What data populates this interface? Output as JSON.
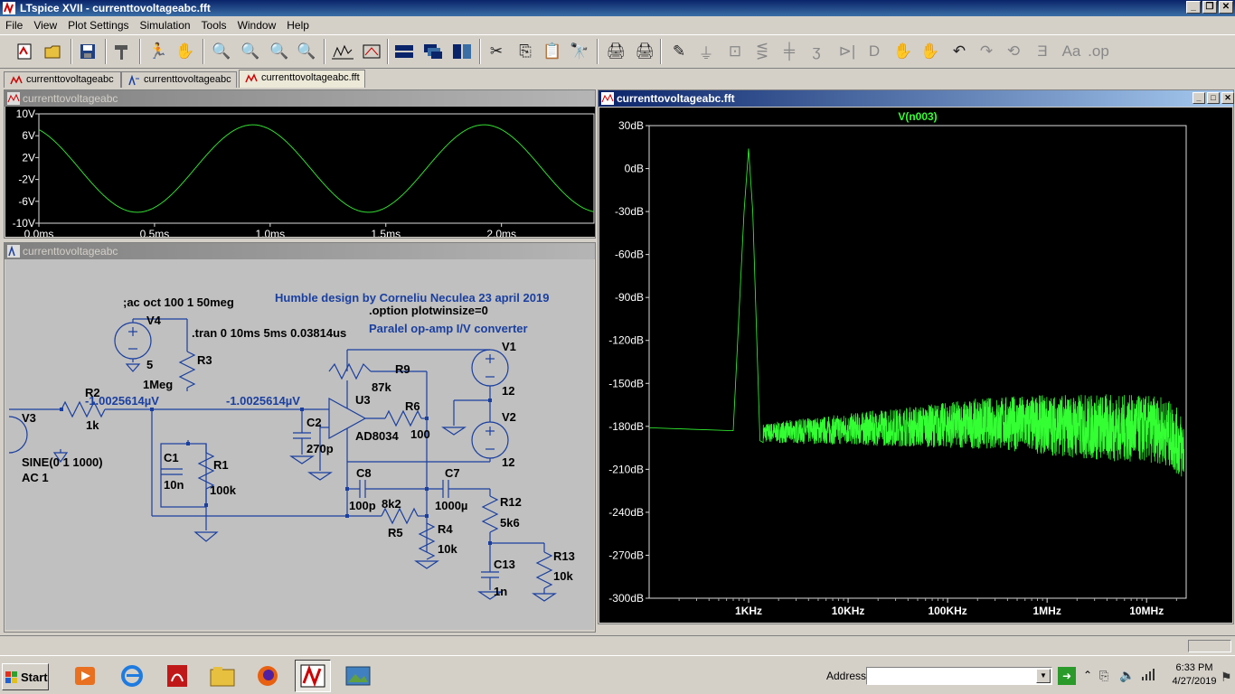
{
  "window": {
    "title": "LTspice XVII - currenttovoltageabc.fft"
  },
  "menu": [
    "File",
    "View",
    "Plot Settings",
    "Simulation",
    "Tools",
    "Window",
    "Help"
  ],
  "tabs": [
    {
      "label": "currenttovoltageabc",
      "type": "waveform"
    },
    {
      "label": "currenttovoltageabc",
      "type": "schematic"
    },
    {
      "label": "currenttovoltageabc.fft",
      "type": "waveform",
      "active": true
    }
  ],
  "transient_window": {
    "title": "currenttovoltageabc",
    "chart_data": {
      "type": "line",
      "series": [
        {
          "name": "",
          "description": "sine 8V amplitude, 1 kHz",
          "amplitude": 8,
          "frequency_hz": 1000
        }
      ],
      "x_ticks": [
        "0.0ms",
        "0.5ms",
        "1.0ms",
        "1.5ms",
        "2.0ms"
      ],
      "y_ticks": [
        "10V",
        "6V",
        "2V",
        "-2V",
        "-6V",
        "-10V"
      ],
      "xlim": [
        0,
        2.4
      ],
      "ylim": [
        -10,
        10
      ],
      "color": "#33dd33"
    }
  },
  "schematic_window": {
    "title": "currenttovoltageabc",
    "texts": {
      "heading": "Humble design by Corneliu Neculea 23 april 2019",
      "option": ".option plotwinsize=0",
      "subtitle": "Paralel op-amp I/V converter",
      "ac_directive": ";ac oct 100 1 50meg",
      "tran_directive": ".tran 0 10ms 5ms 0.03814us",
      "node_voltage_left": "-1.0025614µV",
      "node_voltage_right": "-1.0025614µV",
      "v3_sine": "SINE(0 1 1000)",
      "v3_ac": "AC 1"
    },
    "components": [
      {
        "ref": "V4",
        "value": "5"
      },
      {
        "ref": "R3",
        "value": "1Meg"
      },
      {
        "ref": "R2",
        "value": "1k"
      },
      {
        "ref": "V3",
        "value": ""
      },
      {
        "ref": "C1",
        "value": "10n"
      },
      {
        "ref": "R1",
        "value": "100k"
      },
      {
        "ref": "C2",
        "value": "270p"
      },
      {
        "ref": "U3",
        "value": "AD8034"
      },
      {
        "ref": "R9",
        "value": "87k"
      },
      {
        "ref": "R6",
        "value": "100"
      },
      {
        "ref": "V1",
        "value": "12"
      },
      {
        "ref": "V2",
        "value": "12"
      },
      {
        "ref": "C8",
        "value": "100p"
      },
      {
        "ref": "R5",
        "value": "8k2"
      },
      {
        "ref": "C7",
        "value": "1000µ"
      },
      {
        "ref": "R4",
        "value": "10k"
      },
      {
        "ref": "R12",
        "value": "5k6"
      },
      {
        "ref": "C13",
        "value": "1n"
      },
      {
        "ref": "R13",
        "value": "10k"
      }
    ]
  },
  "fft_window": {
    "title": "currenttovoltageabc.fft",
    "chart_data": {
      "type": "line",
      "title": "V(n003)",
      "series": [
        {
          "name": "V(n003)",
          "description": "FFT spectrum, peak ~14 dB at 1 kHz, noise floor ~-180 dB"
        }
      ],
      "x_scale": "log",
      "xlim_hz": [
        100,
        25000000
      ],
      "x_ticks": [
        "1KHz",
        "10KHz",
        "100KHz",
        "1MHz",
        "10MHz"
      ],
      "y_ticks": [
        "30dB",
        "0dB",
        "-30dB",
        "-60dB",
        "-90dB",
        "-120dB",
        "-150dB",
        "-180dB",
        "-210dB",
        "-240dB",
        "-270dB",
        "-300dB"
      ],
      "ylim": [
        -300,
        30
      ],
      "peak": {
        "freq_hz": 1000,
        "db": 14
      },
      "color": "#33ff33"
    }
  },
  "taskbar": {
    "start": "Start",
    "address_label": "Address",
    "address_value": "",
    "time": "6:33 PM",
    "date": "4/27/2019"
  }
}
